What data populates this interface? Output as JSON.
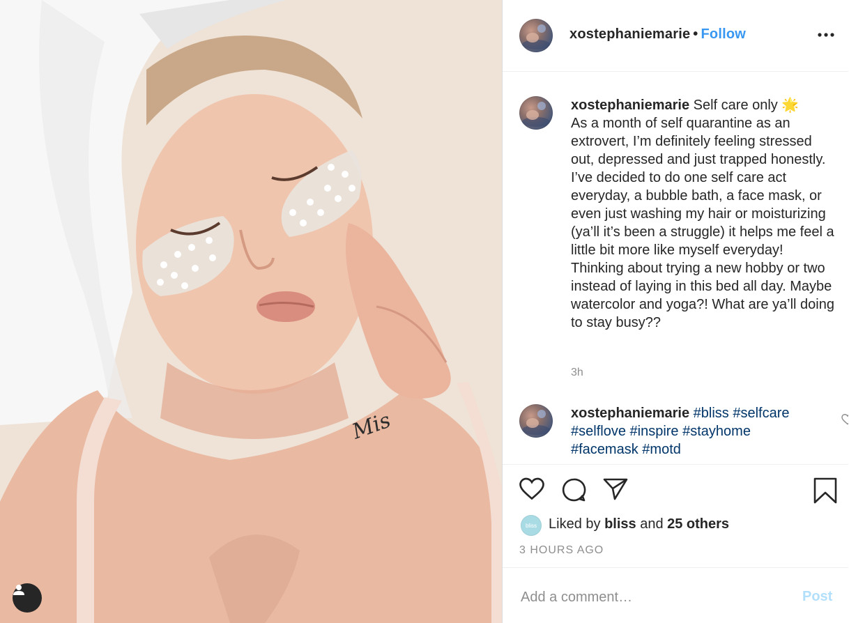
{
  "post": {
    "photo_alt": "Selfie with towel on head and star under-eye patches"
  },
  "header": {
    "username": "xostephaniemarie",
    "dot": "•",
    "follow_label": "Follow",
    "more_icon": "more-horizontal-icon"
  },
  "comments": [
    {
      "username": "xostephaniemarie",
      "text": " Self care only 🌟\nAs a month of self quarantine as an extrovert, I’m definitely feeling stressed out, depressed and just trapped honestly. I’ve decided to do one self care act everyday, a bubble bath, a face mask, or even just washing my hair or moisturizing (ya’ll it’s been a struggle) it helps me feel a little bit more like myself everyday! Thinking about trying a new hobby or two instead of laying in this bed all day. Maybe watercolor and yoga?! What are ya’ll doing to stay busy??",
      "time": "3h"
    },
    {
      "username": "xostephaniemarie",
      "hashtags": [
        "#bliss",
        "#selfcare",
        "#selflove",
        "#inspire",
        "#stayhome",
        "#facemask",
        "#motd"
      ]
    }
  ],
  "actions": {
    "like_icon": "heart-icon",
    "comment_icon": "comment-icon",
    "share_icon": "share-icon",
    "save_icon": "bookmark-icon"
  },
  "likes": {
    "avatar_label": "bliss",
    "prefix": "Liked by ",
    "user": "bliss",
    "and": " and ",
    "others": "25 others"
  },
  "timestamp": "3 HOURS AGO",
  "add_comment": {
    "placeholder": "Add a comment…",
    "post_label": "Post"
  },
  "colors": {
    "accent": "#3897f0",
    "post_disabled": "#b2dffc",
    "hashtag": "#003569",
    "muted": "#8e8e8e"
  }
}
